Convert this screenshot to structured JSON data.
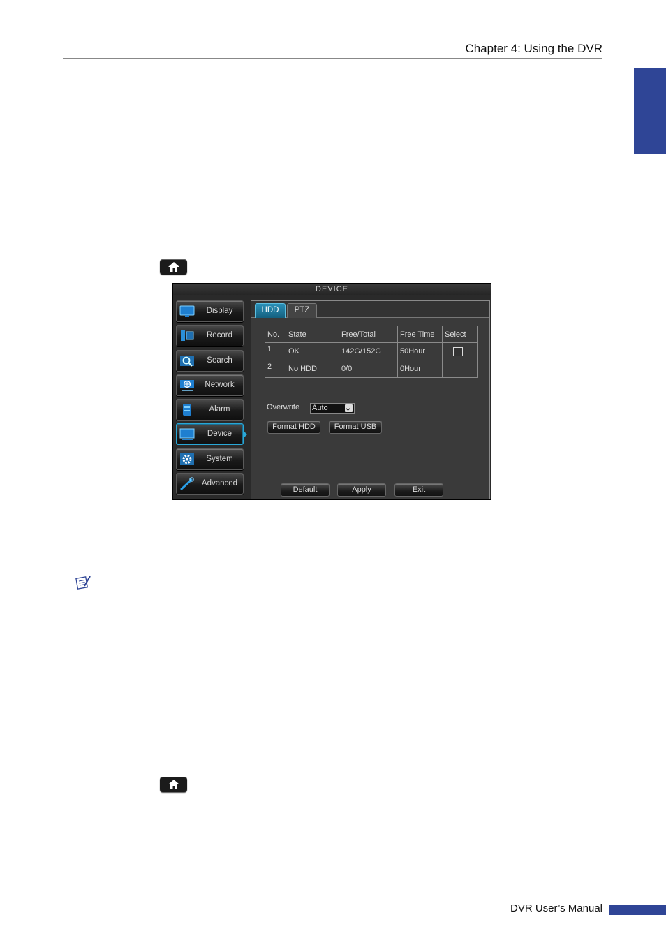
{
  "page": {
    "chapter_title": "Chapter 4: Using the DVR",
    "footer_title": "DVR User’s Manual",
    "colors": {
      "accent": "#2f4596",
      "dvr_highlight": "#29a7d6"
    },
    "icons": [
      "home-icon",
      "note-icon"
    ]
  },
  "dvr": {
    "window_title": "DEVICE",
    "sidebar": [
      {
        "label": "Display",
        "icon": "monitor-icon"
      },
      {
        "label": "Record",
        "icon": "record-icon"
      },
      {
        "label": "Search",
        "icon": "search-icon"
      },
      {
        "label": "Network",
        "icon": "network-icon"
      },
      {
        "label": "Alarm",
        "icon": "alarm-icon"
      },
      {
        "label": "Device",
        "icon": "device-icon",
        "active": true
      },
      {
        "label": "System",
        "icon": "gear-icon"
      },
      {
        "label": "Advanced",
        "icon": "wrench-icon"
      }
    ],
    "tabs": [
      {
        "label": "HDD",
        "active": true
      },
      {
        "label": "PTZ"
      }
    ],
    "table": {
      "headers": [
        "No.",
        "State",
        "Free/Total",
        "Free Time",
        "Select"
      ],
      "rows": [
        {
          "no": "1",
          "state": "OK",
          "free_total": "142G/152G",
          "free_time": "50Hour",
          "select": false
        },
        {
          "no": "2",
          "state": "No HDD",
          "free_total": "0/0",
          "free_time": "0Hour"
        }
      ]
    },
    "overwrite": {
      "label": "Overwrite",
      "value": "Auto"
    },
    "buttons": {
      "format_hdd": "Format HDD",
      "format_usb": "Format USB",
      "default": "Default",
      "apply": "Apply",
      "exit": "Exit"
    }
  }
}
